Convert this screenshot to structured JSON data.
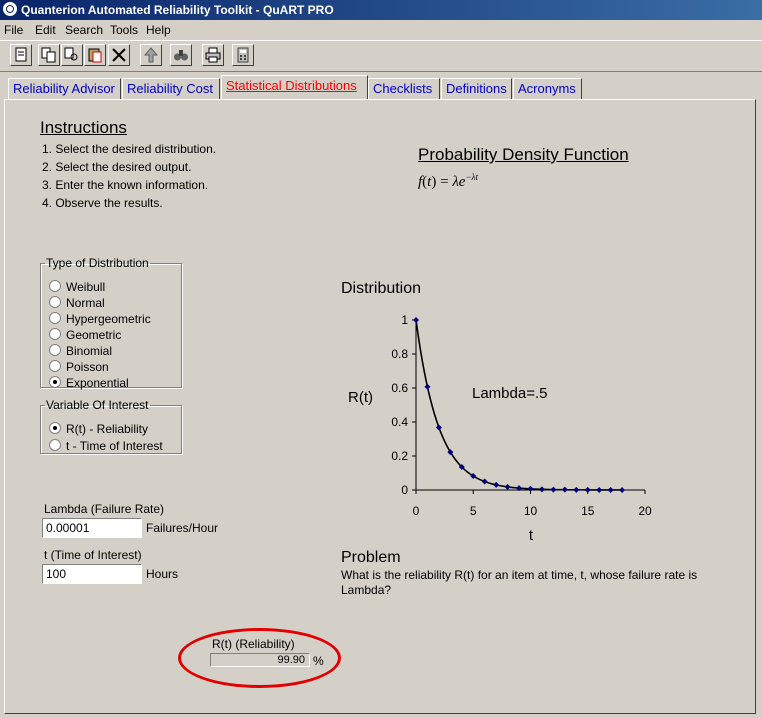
{
  "window": {
    "title": "Quanterion Automated Reliability Toolkit - QuART PRO"
  },
  "menu": [
    "File",
    "Edit",
    "Search",
    "Tools",
    "Help"
  ],
  "toolbar_icons": [
    "new-document-icon",
    "copy-icon",
    "find-replace-icon",
    "paste-icon",
    "delete-icon",
    "upload-icon",
    "binoculars-icon",
    "print-icon",
    "calculator-icon"
  ],
  "tabs": [
    {
      "label": "Reliability Advisor",
      "active": false
    },
    {
      "label": "Reliability Cost",
      "active": false
    },
    {
      "label": "Statistical Distributions",
      "active": true
    },
    {
      "label": "Checklists",
      "active": false
    },
    {
      "label": "Definitions",
      "active": false
    },
    {
      "label": "Acronyms",
      "active": false
    }
  ],
  "instructions": {
    "title": "Instructions",
    "steps": [
      "1. Select the desired distribution.",
      "2. Select the desired output.",
      "3. Enter the known information.",
      "4. Observe the results."
    ]
  },
  "pdf": {
    "title": "Probability Density Function"
  },
  "distribution_type": {
    "legend": "Type of Distribution",
    "options": [
      "Weibull",
      "Normal",
      "Hypergeometric",
      "Geometric",
      "Binomial",
      "Poisson",
      "Exponential"
    ],
    "selected": "Exponential"
  },
  "variable_of_interest": {
    "legend": "Variable Of Interest",
    "options": [
      "R(t) - Reliability",
      "t - Time of Interest"
    ],
    "selected": "R(t) - Reliability"
  },
  "inputs": {
    "lambda_label": "Lambda (Failure Rate)",
    "lambda_value": "0.00001",
    "lambda_units": "Failures/Hour",
    "t_label": "t (Time of Interest)",
    "t_value": "100",
    "t_units": "Hours"
  },
  "result": {
    "label": "R(t) (Reliability)",
    "value": "99.90",
    "unit": "%"
  },
  "problem": {
    "title": "Problem",
    "text_line1": "What is the reliability R(t) for an item at time, t, whose failure rate is",
    "text_line2": "Lambda?"
  },
  "chart_data": {
    "type": "line",
    "title": "Distribution",
    "xlabel": "t",
    "ylabel": "R(t)",
    "annotation": "Lambda=.5",
    "xlim": [
      0,
      20
    ],
    "ylim": [
      0,
      1
    ],
    "xticks": [
      0,
      5,
      10,
      15,
      20
    ],
    "yticks": [
      0,
      0.2,
      0.4,
      0.6,
      0.8,
      1
    ],
    "ytick_labels": [
      "0",
      "0.2",
      "0.4",
      "0.6",
      "0.8",
      "1"
    ],
    "x": [
      0,
      1,
      2,
      3,
      4,
      5,
      6,
      7,
      8,
      9,
      10,
      11,
      12,
      13,
      14,
      15,
      16,
      17,
      18
    ],
    "y": [
      1,
      0.607,
      0.368,
      0.223,
      0.135,
      0.082,
      0.05,
      0.03,
      0.018,
      0.011,
      0.007,
      0.004,
      0.002,
      0.002,
      0.001,
      0.001,
      0,
      0,
      0
    ],
    "grid": false,
    "marker_color": "#000080",
    "line_color": "#000000"
  }
}
